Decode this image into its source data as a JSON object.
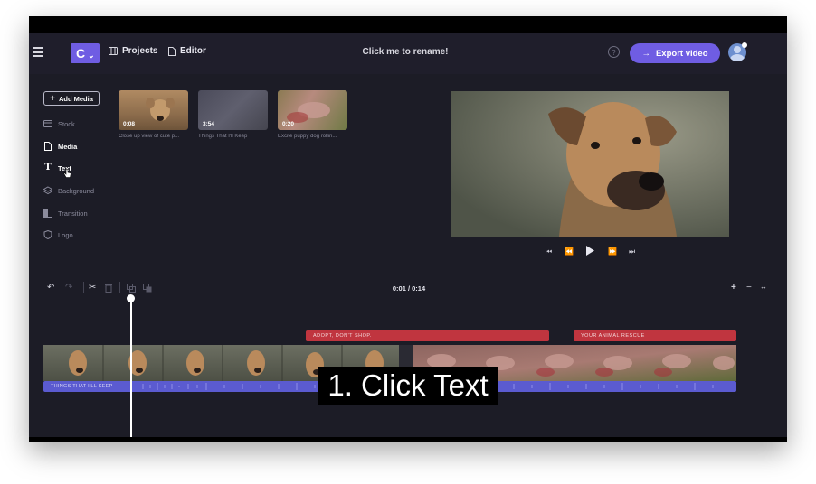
{
  "topbar": {
    "logo_letter": "C",
    "nav_projects": "Projects",
    "nav_editor": "Editor",
    "title": "Click me to rename!",
    "help": "?",
    "export_label": "Export video"
  },
  "sidebar": {
    "add_media_label": "Add Media",
    "items": [
      {
        "label": "Stock",
        "icon": "stock-icon",
        "active": false
      },
      {
        "label": "Media",
        "icon": "media-icon",
        "active": true
      },
      {
        "label": "Text",
        "icon": "text-icon",
        "active": true
      },
      {
        "label": "Background",
        "icon": "layers-icon",
        "active": false
      },
      {
        "label": "Transition",
        "icon": "transition-icon",
        "active": false
      },
      {
        "label": "Logo",
        "icon": "shield-icon",
        "active": false
      }
    ]
  },
  "media": [
    {
      "duration": "0:08",
      "caption": "Close up view of cute p..."
    },
    {
      "duration": "3:54",
      "caption": "Things That I'll Keep"
    },
    {
      "duration": "0:20",
      "caption": "Excite puppy dog rollin..."
    }
  ],
  "timeline": {
    "time": "0:01 / 0:14",
    "text_clips": [
      "ADOPT, DON'T SHOP.",
      "YOUR ANIMAL RESCUE"
    ],
    "audio_label": "THINGS THAT I'LL KEEP",
    "plus": "+",
    "minus": "−",
    "fit": "↔"
  },
  "overlay_caption": "1. Click Text",
  "colors": {
    "accent": "#6f5de3",
    "text_clip": "#c0353f",
    "audio_track": "#5b5bd0"
  }
}
